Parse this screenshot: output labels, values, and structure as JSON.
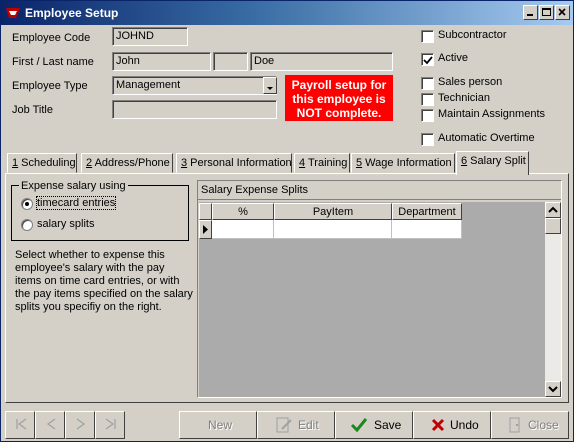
{
  "window": {
    "title": "Employee Setup"
  },
  "form": {
    "employee_code_label": "Employee Code",
    "employee_code": "JOHND",
    "name_label": "First / Last name",
    "first_name": "John",
    "middle_initial": "",
    "last_name": "Doe",
    "employee_type_label": "Employee Type",
    "employee_type": "Management",
    "job_title_label": "Job Title",
    "job_title": "",
    "warning": "Payroll setup for this employee is NOT complete."
  },
  "checkboxes": {
    "subcontractor": {
      "label": "Subcontractor",
      "checked": false
    },
    "active": {
      "label": "Active",
      "checked": true
    },
    "sales_person": {
      "label": "Sales person",
      "checked": false
    },
    "technician": {
      "label": "Technician",
      "checked": false
    },
    "maintain_assignments": {
      "label": "Maintain Assignments",
      "checked": false
    },
    "automatic_overtime": {
      "label": "Automatic Overtime",
      "checked": false
    }
  },
  "tabs": [
    {
      "num": "1",
      "label": " Scheduling"
    },
    {
      "num": "2",
      "label": " Address/Phone"
    },
    {
      "num": "3",
      "label": " Personal Information"
    },
    {
      "num": "4",
      "label": " Training"
    },
    {
      "num": "5",
      "label": " Wage Information"
    },
    {
      "num": "6",
      "label": " Salary Split"
    }
  ],
  "active_tab": "6",
  "expense": {
    "group_title": "Expense salary using",
    "options": [
      "timecard entries",
      "salary splits"
    ],
    "selected": "timecard entries",
    "description": "Select whether to expense this employee's salary with the pay items on time card entries, or with the pay items specified on the salary splits you specifiy on the right."
  },
  "splits": {
    "title": "Salary Expense Splits",
    "columns": [
      "%",
      "PayItem",
      "Department"
    ],
    "rows": [
      [
        "",
        "",
        ""
      ]
    ]
  },
  "toolbar": {
    "new": "New",
    "edit": "Edit",
    "save": "Save",
    "undo": "Undo",
    "close": "Close"
  },
  "colors": {
    "warning_bg": "#ff0000",
    "titlebar": "#0a246a",
    "check": "#000000"
  }
}
